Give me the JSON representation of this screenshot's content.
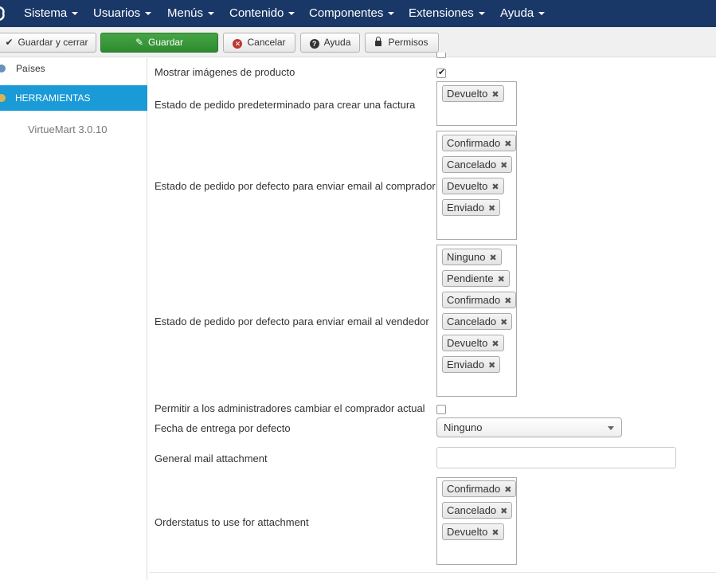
{
  "nav": {
    "items": [
      "Sistema",
      "Usuarios",
      "Menús",
      "Contenido",
      "Componentes",
      "Extensiones",
      "Ayuda"
    ]
  },
  "toolbar": {
    "save_close": "Guardar y cerrar",
    "save": "Guardar",
    "cancel": "Cancelar",
    "help": "Ayuda",
    "permissions": "Permisos"
  },
  "sidebar": {
    "items": [
      {
        "label": "Países",
        "icon": "globe-icon"
      },
      {
        "label": "HERRAMIENTAS",
        "icon": "tools-icon",
        "active": true
      }
    ],
    "version": "VirtueMart 3.0.10"
  },
  "form": {
    "show_images_label": "Mostrar imágenes de producto",
    "invoice_status_label": "Estado de pedido predeterminado para crear una factura",
    "invoice_status_tags": [
      "Devuelto"
    ],
    "buyer_email_label": "Estado de pedido por defecto para enviar email al comprador",
    "buyer_email_tags": [
      "Confirmado",
      "Cancelado",
      "Devuelto",
      "Enviado"
    ],
    "vendor_email_label": "Estado de pedido por defecto para enviar email al vendedor",
    "vendor_email_tags": [
      "Ninguno",
      "Pendiente",
      "Confirmado",
      "Cancelado",
      "Devuelto",
      "Enviado"
    ],
    "admin_change_buyer_label": "Permitir a los administradores cambiar el comprador actual",
    "delivery_date_label": "Fecha de entrega por defecto",
    "delivery_date_value": "Ninguno",
    "mail_attachment_label": "General mail attachment",
    "mail_attachment_value": "",
    "attachment_status_label": "Orderstatus to use for attachment",
    "attachment_status_tags": [
      "Confirmado",
      "Cancelado",
      "Devuelto"
    ]
  },
  "colors": {
    "navbar": "#1a3867",
    "save_button": "#46a546",
    "sidebar_active": "#1a9ad6"
  }
}
